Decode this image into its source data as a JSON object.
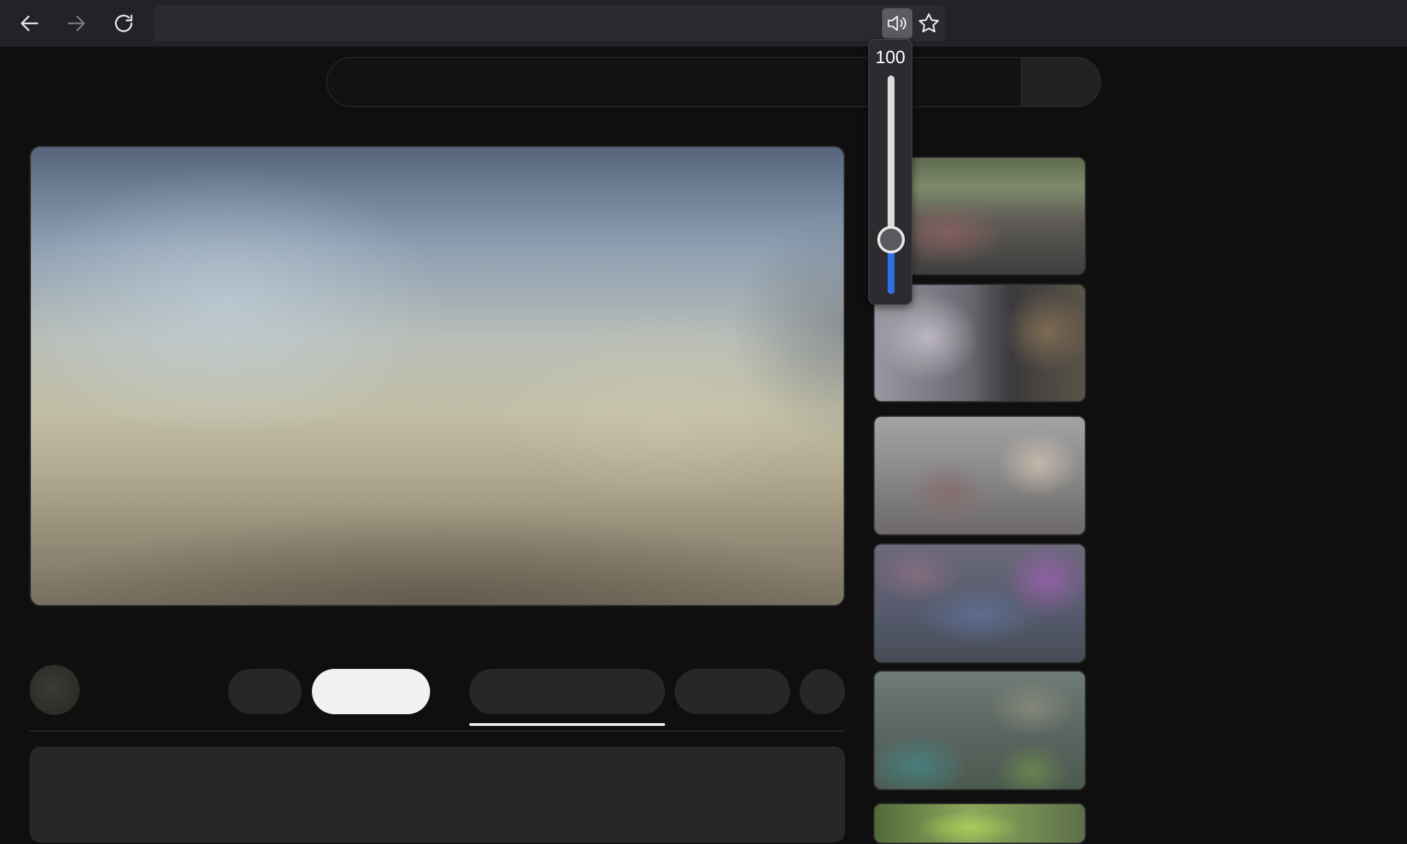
{
  "browser": {
    "url": "",
    "icons": {
      "back": "arrow-left-icon",
      "forward": "arrow-right-icon",
      "reload": "reload-icon",
      "speaker": "speaker-icon",
      "bookmark": "star-icon"
    },
    "forward_enabled": false
  },
  "volume": {
    "value": "100",
    "level_fraction": 0.25,
    "accent_color": "#2f6fe4"
  },
  "page": {
    "search": {
      "placeholder": ""
    },
    "recommendations_count": 6
  }
}
